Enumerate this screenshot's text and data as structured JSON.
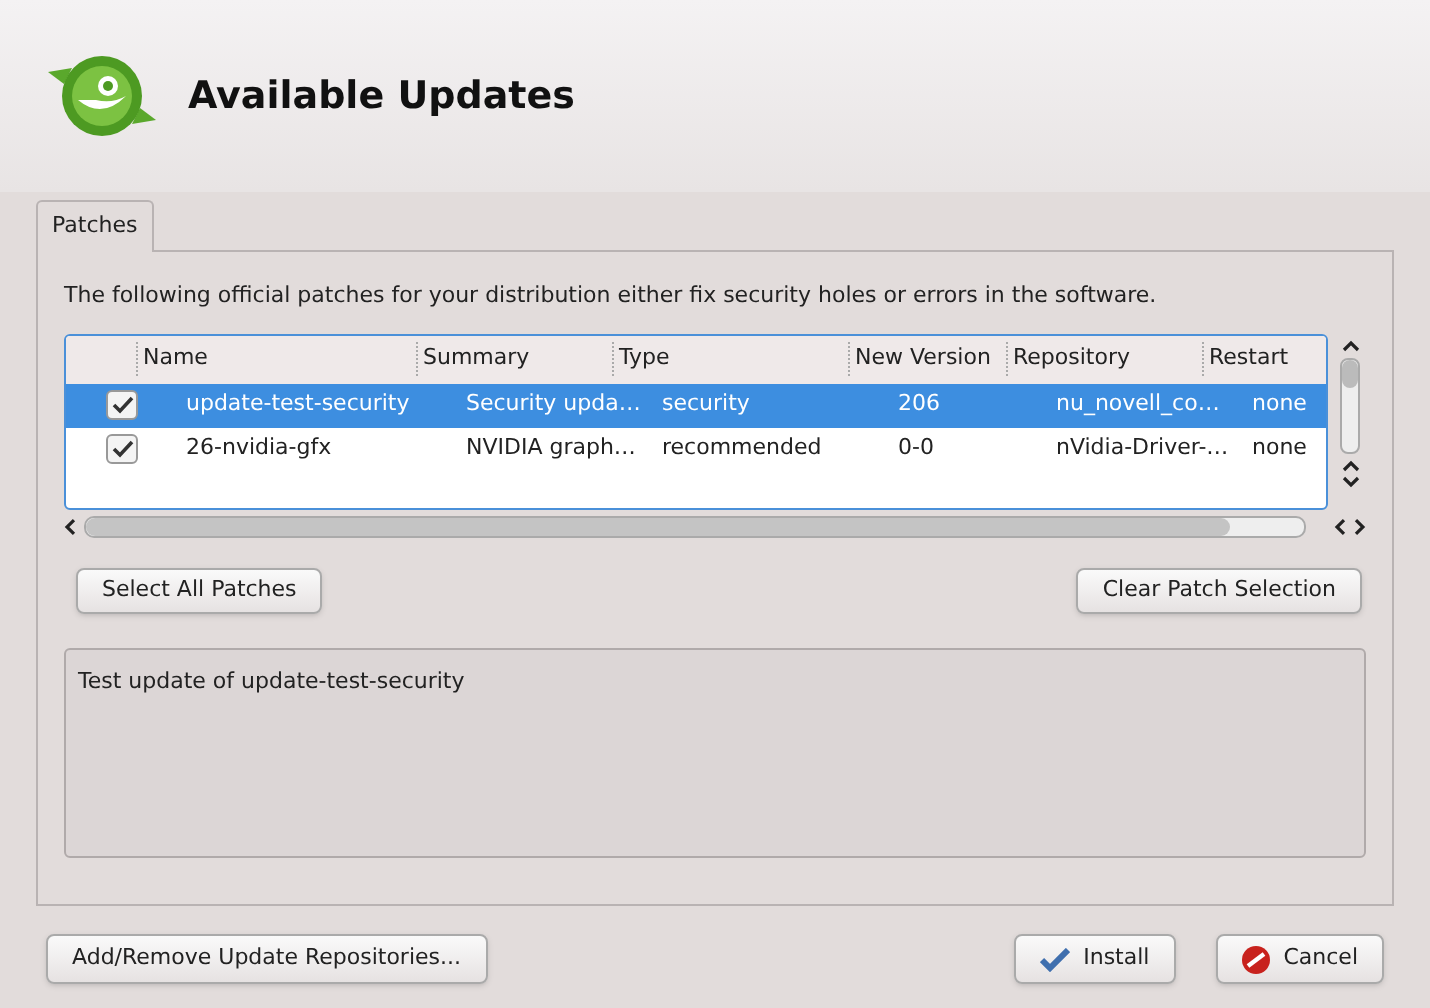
{
  "header": {
    "title": "Available Updates"
  },
  "tabs": [
    {
      "label": "Patches",
      "selected": true
    }
  ],
  "description": "The following official patches for your distribution either fix security holes or errors in the software.",
  "table": {
    "columns": [
      "Name",
      "Summary",
      "Type",
      "New Version",
      "Repository",
      "Restart"
    ],
    "rows": [
      {
        "checked": true,
        "selected": true,
        "cells": [
          "update-test-security",
          "Security upda…",
          "security",
          "206",
          "nu_novell_co…",
          "none"
        ]
      },
      {
        "checked": true,
        "selected": false,
        "cells": [
          "26-nvidia-gfx",
          "NVIDIA graph…",
          "recommended",
          "0-0",
          "nVidia-Driver-…",
          "none"
        ]
      }
    ]
  },
  "actions": [
    "Select All Patches",
    "Clear Patch Selection"
  ],
  "details": "Test update of update-test-security",
  "footer": {
    "left": "Add/Remove Update Repositories...",
    "buttons": [
      {
        "kind": "install",
        "label": "Install"
      },
      {
        "kind": "cancel",
        "label": "Cancel"
      }
    ]
  }
}
